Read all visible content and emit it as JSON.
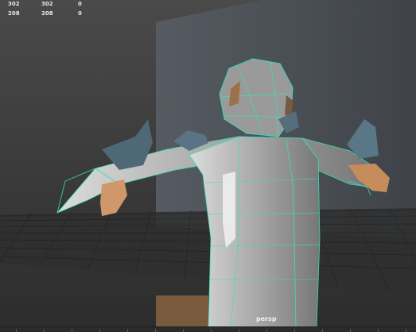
{
  "heads_up_display": {
    "rows": [
      [
        "302",
        "302",
        "0"
      ],
      [
        "208",
        "208",
        "0"
      ]
    ]
  },
  "viewport": {
    "camera_label": "persp",
    "wireframe_color": "#37e0b8",
    "background_color": "#3d3d3d",
    "wall_color": "#4c5056"
  },
  "icons": {
    "model": "low-poly-character-model",
    "grid": "ground-grid"
  }
}
